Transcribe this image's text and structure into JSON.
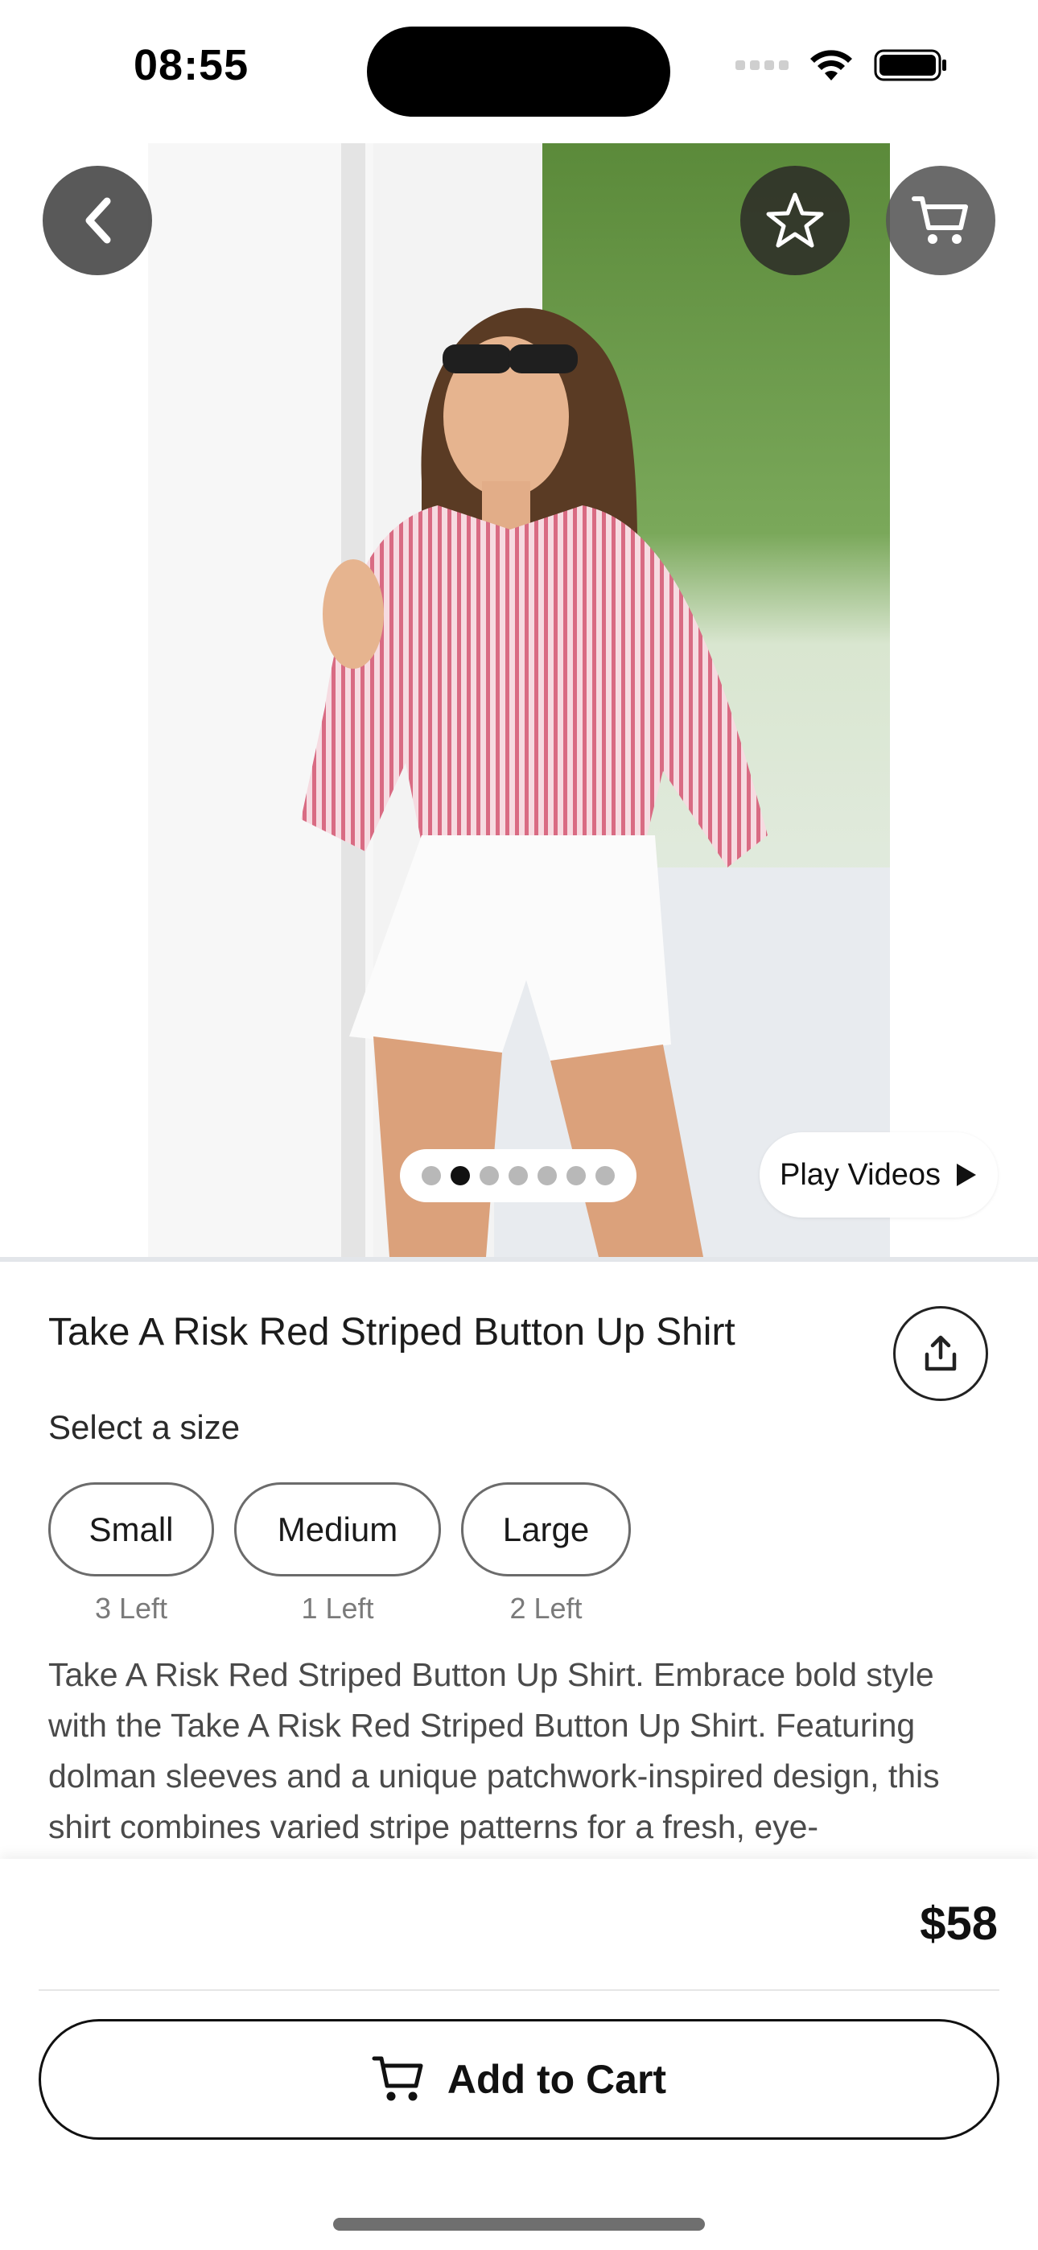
{
  "status_bar": {
    "time": "08:55"
  },
  "hero": {
    "image_alt": "Model wearing red striped button up shirt and white shorts",
    "carousel_total": 7,
    "carousel_active": 1,
    "play_videos_label": "Play Videos"
  },
  "product": {
    "title": "Take A Risk Red Striped Button Up Shirt",
    "size_prompt": "Select a size",
    "sizes": [
      {
        "label": "Small",
        "stock": "3 Left"
      },
      {
        "label": "Medium",
        "stock": "1 Left"
      },
      {
        "label": "Large",
        "stock": "2 Left"
      }
    ],
    "description": "Take A Risk Red Striped Button Up Shirt. Embrace bold style with the Take A Risk Red Striped Button Up Shirt. Featuring dolman sleeves and a unique patchwork-inspired design, this shirt combines varied stripe patterns for a fresh, eye-"
  },
  "checkout": {
    "price": "$58",
    "add_to_cart_label": "Add to Cart"
  },
  "icons": {
    "back": "chevron-left-icon",
    "favorite": "star-icon",
    "cart": "cart-icon",
    "share": "share-icon",
    "play": "play-icon"
  },
  "colors": {
    "overlay_button": "#3c3c3c",
    "text_primary": "#1a1a1a",
    "text_secondary": "#7a7a7a"
  }
}
